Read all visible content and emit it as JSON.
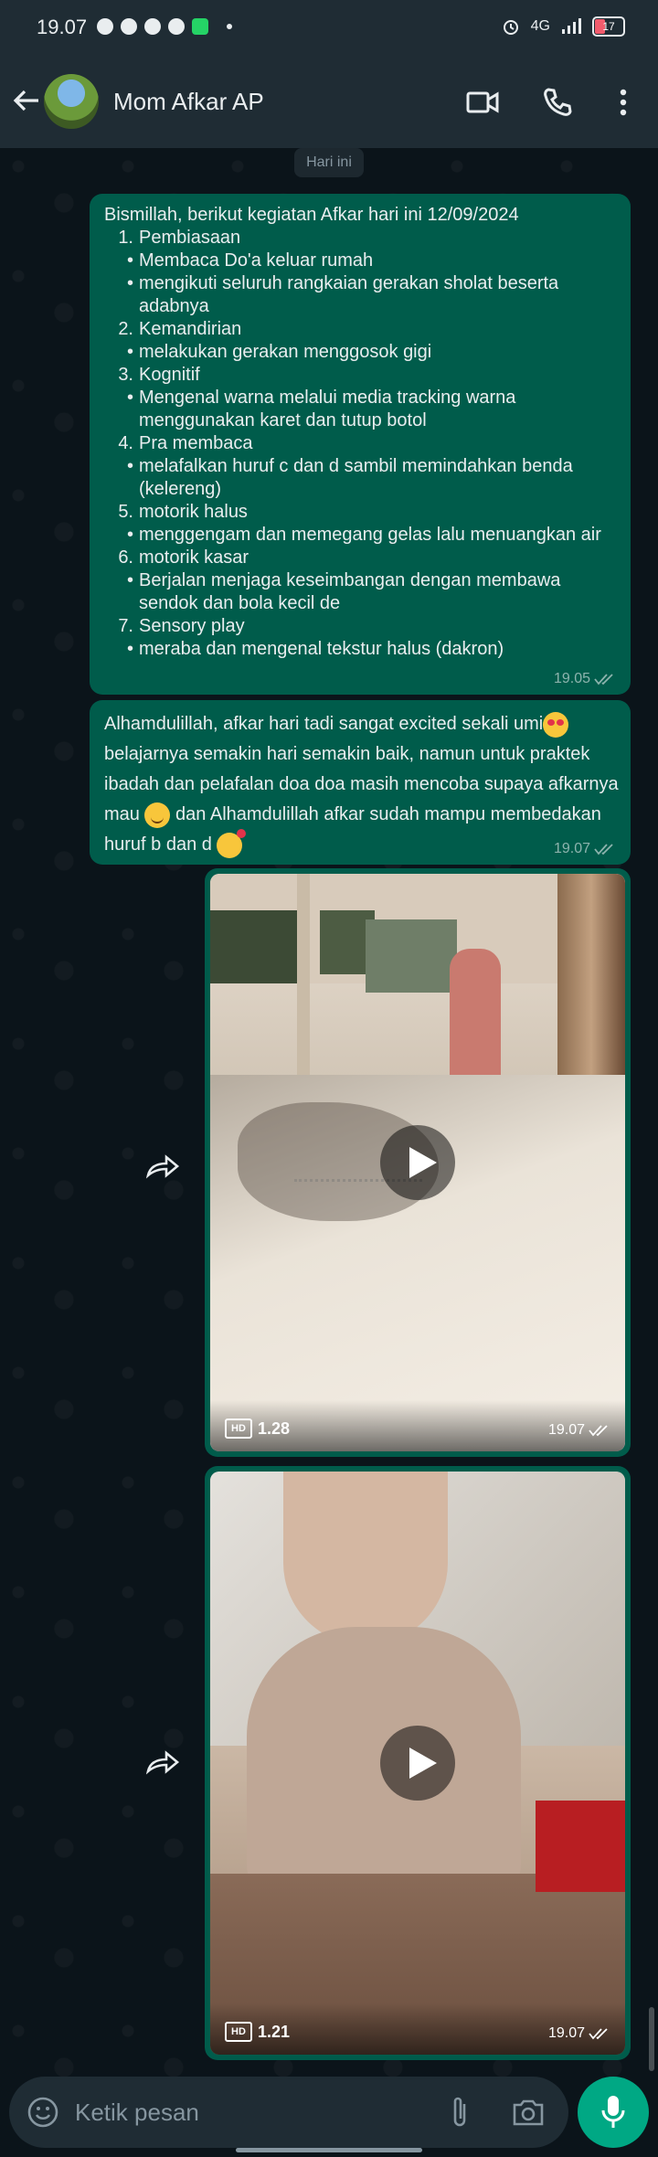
{
  "status_bar": {
    "time": "19.07",
    "signal_label": "4G",
    "battery": "17"
  },
  "header": {
    "contact_name": "Mom Afkar AP"
  },
  "date_chip": "Hari ini",
  "message1": {
    "title": "Bismillah, berikut kegiatan Afkar hari ini 12/09/2024",
    "lines": [
      {
        "marker": "1.",
        "text": "Pembiasaan"
      },
      {
        "marker": "•",
        "text": "Membaca Do'a keluar rumah"
      },
      {
        "marker": "•",
        "text": "mengikuti seluruh rangkaian gerakan sholat beserta adabnya"
      },
      {
        "marker": "2.",
        "text": "Kemandirian"
      },
      {
        "marker": "•",
        "text": "melakukan gerakan menggosok gigi"
      },
      {
        "marker": "3.",
        "text": "Kognitif"
      },
      {
        "marker": "•",
        "text": "Mengenal warna melalui media tracking warna menggunakan karet dan tutup botol"
      },
      {
        "marker": "4.",
        "text": "Pra membaca"
      },
      {
        "marker": "•",
        "text": "melafalkan huruf c dan d sambil memindahkan benda (kelereng)"
      },
      {
        "marker": "5.",
        "text": "motorik halus"
      },
      {
        "marker": "•",
        "text": "menggengam dan memegang gelas lalu menuangkan air"
      },
      {
        "marker": "6.",
        "text": "motorik kasar"
      },
      {
        "marker": "•",
        "text": "Berjalan menjaga keseimbangan dengan membawa sendok dan bola kecil de"
      },
      {
        "marker": "7.",
        "text": "Sensory play"
      },
      {
        "marker": "•",
        "text": "meraba dan mengenal tekstur halus (dakron)"
      }
    ],
    "time": "19.05"
  },
  "message2": {
    "part1": "Alhamdulillah, afkar hari tadi sangat excited sekali umi",
    "part2": "belajarnya semakin hari semakin baik, namun untuk praktek ibadah dan pelafalan doa doa masih mencoba supaya afkarnya mau ",
    "part3": " dan Alhamdulillah afkar sudah mampu membedakan huruf b dan d ",
    "time": "19.07"
  },
  "video1": {
    "hd_label": "HD",
    "duration": "1.28",
    "time": "19.07"
  },
  "video2": {
    "hd_label": "HD",
    "duration": "1.21",
    "time": "19.07"
  },
  "input": {
    "placeholder": "Ketik pesan"
  },
  "colors": {
    "bubble_out": "#005c4b",
    "header": "#1f2c34",
    "accent": "#00a884",
    "background": "#0b141a"
  }
}
